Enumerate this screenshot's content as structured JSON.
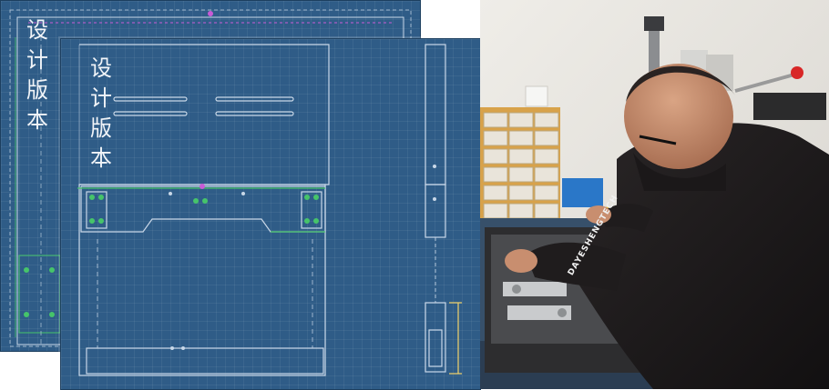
{
  "drawings": {
    "back_label": "设计版本",
    "front_label": "设计版本"
  },
  "photo": {
    "sleeve_text": "DAYESHENGTECH"
  },
  "colors": {
    "blueprint": "#2f5c87",
    "blueprint_line": "#c9d8e8",
    "cad_green": "#46c46a",
    "cad_magenta": "#c85bd6",
    "wall": "#e9e6e0",
    "shirt": "#1d1a1b"
  }
}
